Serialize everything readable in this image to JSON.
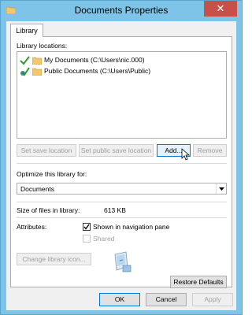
{
  "window": {
    "title": "Documents Properties",
    "close_glyph": "✕"
  },
  "tabs": [
    {
      "label": "Library"
    }
  ],
  "library": {
    "locations_label": "Library locations:",
    "locations": [
      {
        "text": "My Documents (C:\\Users\\nic.000)",
        "status_icon": "check-icon"
      },
      {
        "text": "Public Documents (C:\\Users\\Public)",
        "status_icon": "public-save-check-icon"
      }
    ],
    "buttons": {
      "set_save": "Set save location",
      "set_public_save": "Set public save location",
      "add": "Add...",
      "remove": "Remove"
    },
    "optimize_label": "Optimize this library for:",
    "optimize_value": "Documents",
    "size_label": "Size of files in library:",
    "size_value": "613 KB",
    "attributes_label": "Attributes:",
    "shown_in_nav_label": "Shown in navigation pane",
    "shown_in_nav_checked": true,
    "shared_label": "Shared",
    "shared_checked": false,
    "change_icon_label": "Change library icon...",
    "restore_defaults_label": "Restore Defaults"
  },
  "footer": {
    "ok": "OK",
    "cancel": "Cancel",
    "apply": "Apply"
  },
  "colors": {
    "title_bar": "#7ec4e8",
    "close_button": "#c7504a",
    "accent": "#0078d7"
  }
}
